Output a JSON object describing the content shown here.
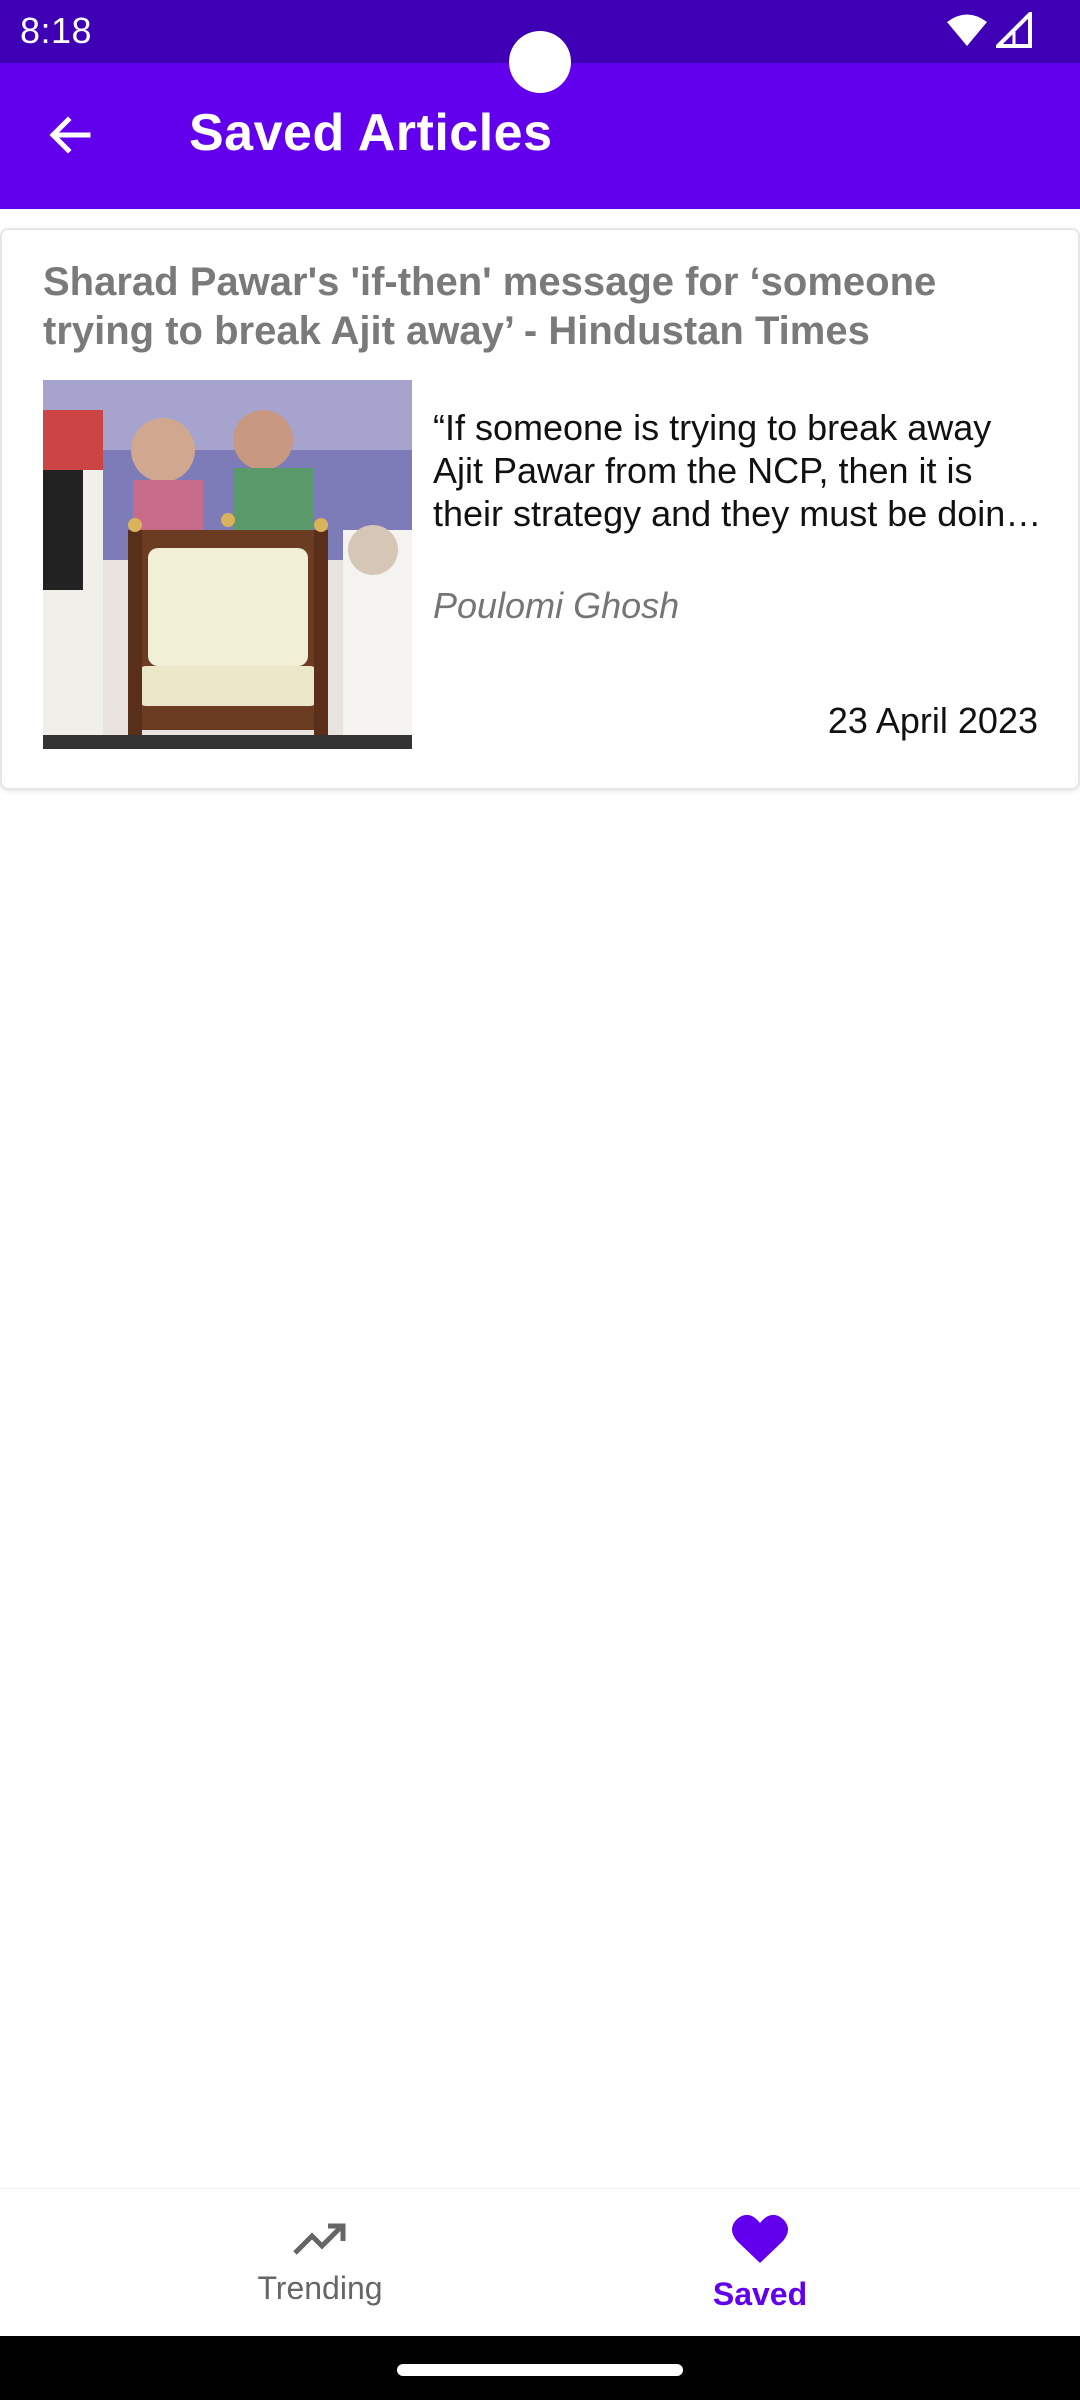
{
  "status_bar": {
    "time": "8:18",
    "icons": [
      "wifi-icon",
      "signal-icon"
    ]
  },
  "app_bar": {
    "title": "Saved Articles",
    "back_icon": "arrow-back-icon",
    "background": "#6200ee"
  },
  "articles": [
    {
      "title": "Sharad Pawar's 'if-then' message for ‘someone trying to break Ajit away’ - Hindustan Times",
      "description": "“If someone is trying to break away Ajit Pawar from the NCP, then it is their strategy and they must be doing it.",
      "author": "Poulomi Ghosh",
      "date": "23 April 2023"
    }
  ],
  "bottom_nav": {
    "items": [
      {
        "label": "Trending",
        "icon": "trending-up-icon",
        "active": false
      },
      {
        "label": "Saved",
        "icon": "heart-icon",
        "active": true
      }
    ],
    "accent": "#6200ee"
  }
}
